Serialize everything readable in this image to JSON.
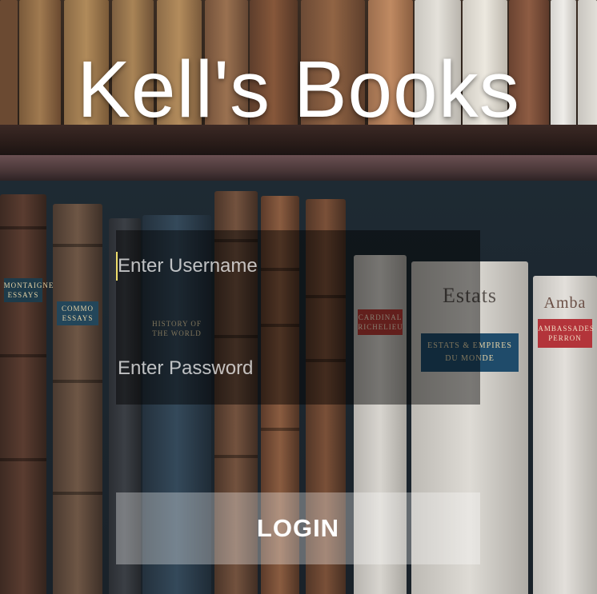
{
  "app": {
    "title": "Kell's Books"
  },
  "login": {
    "username_placeholder": "Enter Username",
    "username_value": "",
    "password_placeholder": "Enter Password",
    "password_value": "",
    "login_label": "LOGIN"
  },
  "background": {
    "spine_labels": [
      "MONTAIGNE ESSAYS",
      "COMMO ESSAYS",
      "HISTORY OF THE WORLD",
      "CARDINAL RICHELIEU",
      "ESTATS & EMPIRES DU MONDE",
      "Estats",
      "AMBASSADES PERRON",
      "Amba"
    ]
  },
  "colors": {
    "title": "#ffffff",
    "panel": "rgba(0,0,0,0.45)",
    "button": "rgba(255,255,255,0.32)",
    "cursor": "#f0df6b"
  }
}
